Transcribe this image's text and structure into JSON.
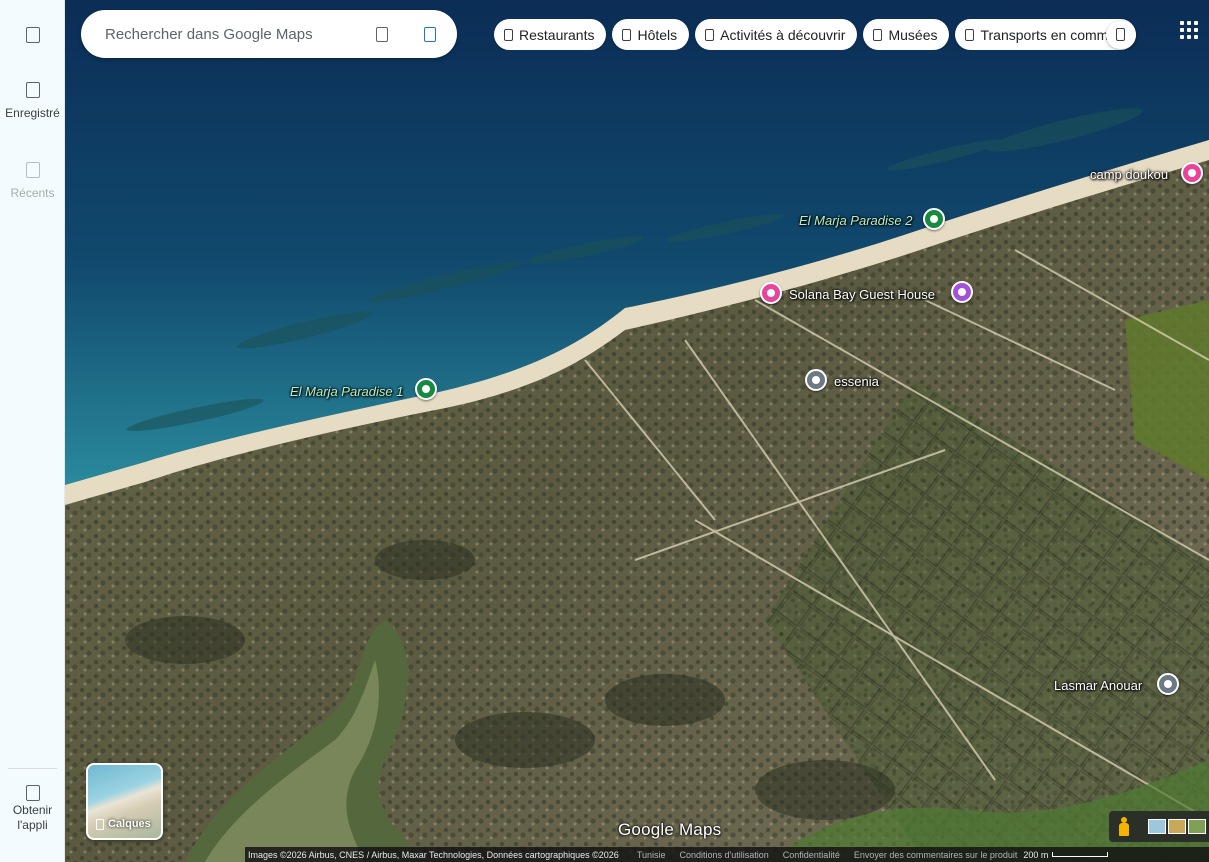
{
  "rail": {
    "menu_icon": "menu-icon",
    "saved_label": "Enregistré",
    "saved_icon": "bookmark-icon",
    "recents_label": "Récents",
    "recents_icon": "history-icon",
    "get_app_label_1": "Obtenir",
    "get_app_label_2": "l'appli",
    "get_app_icon": "phone-icon"
  },
  "search": {
    "placeholder": "Rechercher dans Google Maps",
    "search_icon": "search-icon",
    "directions_icon": "directions-icon"
  },
  "chips": [
    {
      "label": "Restaurants",
      "icon": "restaurant-icon"
    },
    {
      "label": "Hôtels",
      "icon": "hotel-icon"
    },
    {
      "label": "Activités à découvrir",
      "icon": "camera-icon"
    },
    {
      "label": "Musées",
      "icon": "museum-icon"
    },
    {
      "label": "Transports en commun",
      "icon": "transit-icon"
    }
  ],
  "chips_more_icon": "chevron-right-icon",
  "apps_icon": "apps-grid-icon",
  "places": [
    {
      "name": "camp doukou",
      "type": "hotel",
      "color": "#e8449a"
    },
    {
      "name": "El Marja Paradise 2",
      "type": "park",
      "color": "#168a3e"
    },
    {
      "name": "Solana Bay Guest House",
      "type": "hotel",
      "color": "#e8449a"
    },
    {
      "name": "essenia",
      "type": "generic",
      "color": "#6d7a86"
    },
    {
      "name": "El Marja Paradise 1",
      "type": "park",
      "color": "#168a3e"
    },
    {
      "name": "Lasmar Anouar",
      "type": "generic",
      "color": "#6d7a86"
    }
  ],
  "attraction_pin_color": "#a352d8",
  "layers": {
    "label": "Calques",
    "icon": "layers-icon"
  },
  "logo": "Google Maps",
  "pegman_icon": "pegman-icon",
  "attribution": {
    "imagery": "Images ©2026 Airbus, CNES / Airbus, Maxar Technologies, Données cartographiques ©2026",
    "country": "Tunisie",
    "terms": "Conditions d'utilisation",
    "privacy": "Confidentialité",
    "feedback": "Envoyer des commentaires sur le produit",
    "scale": "200 m"
  },
  "colors": {
    "deep_sea": "#0b2d56",
    "shallow_sea": "#2a8a9c",
    "beach": "#e6dcc3",
    "scrub": "#5b5a40",
    "lagoon": "#6c7f52"
  }
}
